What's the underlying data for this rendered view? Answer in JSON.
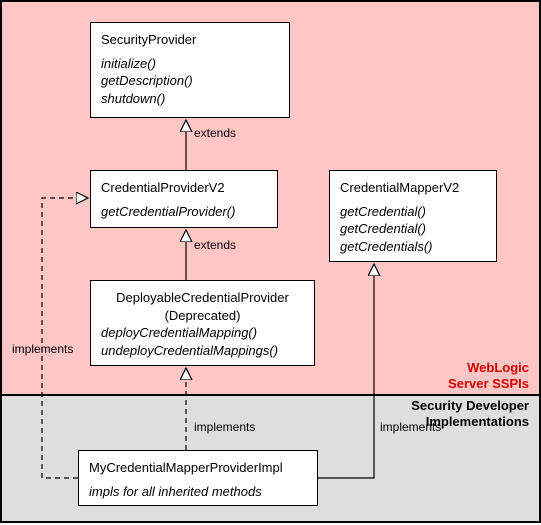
{
  "regions": {
    "top_label_line1": "WebLogic",
    "top_label_line2": "Server SSPIs",
    "bottom_label_line1": "Security Developer",
    "bottom_label_line2": "Implementations"
  },
  "boxes": {
    "security_provider": {
      "title": "SecurityProvider",
      "m1": "initialize()",
      "m2": "getDescription()",
      "m3": "shutdown()"
    },
    "credential_provider_v2": {
      "title": "CredentialProviderV2",
      "m1": "getCredentialProvider()"
    },
    "credential_mapper_v2": {
      "title": "CredentialMapperV2",
      "m1": "getCredential()",
      "m2": "getCredential()",
      "m3": "getCredentials()"
    },
    "deployable_credential_provider": {
      "title_line1": "DeployableCredentialProvider",
      "title_line2": "(Deprecated)",
      "m1": "deployCredentialMapping()",
      "m2": "undeployCredentialMappings()"
    },
    "impl": {
      "title": "MyCredentialMapperProviderImpl",
      "note": "impls for all inherited methods"
    }
  },
  "edges": {
    "extends1": "extends",
    "extends2": "extends",
    "implements1": "implements",
    "implements2": "implements",
    "implements3": "implements"
  }
}
